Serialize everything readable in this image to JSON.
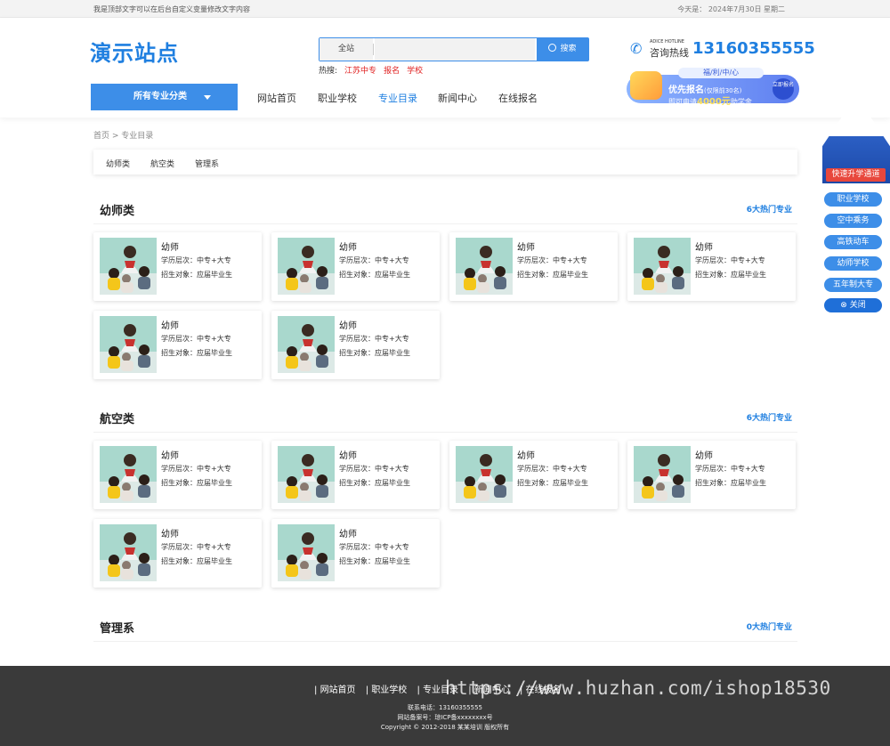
{
  "topbar": {
    "left_text": "我是顶部文字可以在后台自定义变量修改文字内容",
    "right_text": "今天是：  2024年7月30日  星期二"
  },
  "header": {
    "logo": "演示站点",
    "search": {
      "scope": "全站",
      "button": "搜索",
      "hot_label": "热搜:",
      "hot_items": [
        "江苏中专",
        "报名",
        "学校"
      ]
    },
    "hotline": {
      "en_label": "ADICE HOTLINE",
      "label": "咨询热线",
      "number": "13160355555"
    },
    "banner": {
      "tag": "福/利/中/心",
      "title": "优先报名",
      "title_note": "(仅限前30名)",
      "line2_prefix": "即可申请",
      "line2_amount": "4000元",
      "line2_suffix": "助学金",
      "button": "立即报名"
    },
    "category_button": "所有专业分类",
    "nav": [
      "网站首页",
      "职业学校",
      "专业目录",
      "新闻中心",
      "在线报名"
    ],
    "nav_active_index": 2
  },
  "breadcrumb": "首页 > 专业目录",
  "subnav": [
    "幼师类",
    "航空类",
    "管理系"
  ],
  "sections": [
    {
      "title": "幼师类",
      "count": "6大热门专业"
    },
    {
      "title": "航空类",
      "count": "6大热门专业"
    },
    {
      "title": "管理系",
      "count": "0大热门专业"
    }
  ],
  "card": {
    "name": "幼师",
    "line1": "学历层次：中专+大专",
    "line2": "招生对象：应届毕业生"
  },
  "float_panel": {
    "cta": "快速升学通道",
    "items": [
      "职业学校",
      "空中乘务",
      "高铁动车",
      "幼师学校",
      "五年制大专"
    ],
    "close": "关闭"
  },
  "footer": {
    "links": [
      "网站首页",
      "职业学校",
      "专业目录",
      "新闻中心",
      "在线报名"
    ],
    "phone": "联系电话：13160355555",
    "icp": "网站备案号：琼ICP备xxxxxxxx号",
    "copyright": "Copyright © 2012-2018 某某培训 版权所有",
    "watermark": "https://www.huzhan.com/ishop18530"
  },
  "colors": {
    "brand": "#1f7fe0",
    "button": "#3d8ee8",
    "hot": "#e02020",
    "footer": "#3a3a3a"
  }
}
